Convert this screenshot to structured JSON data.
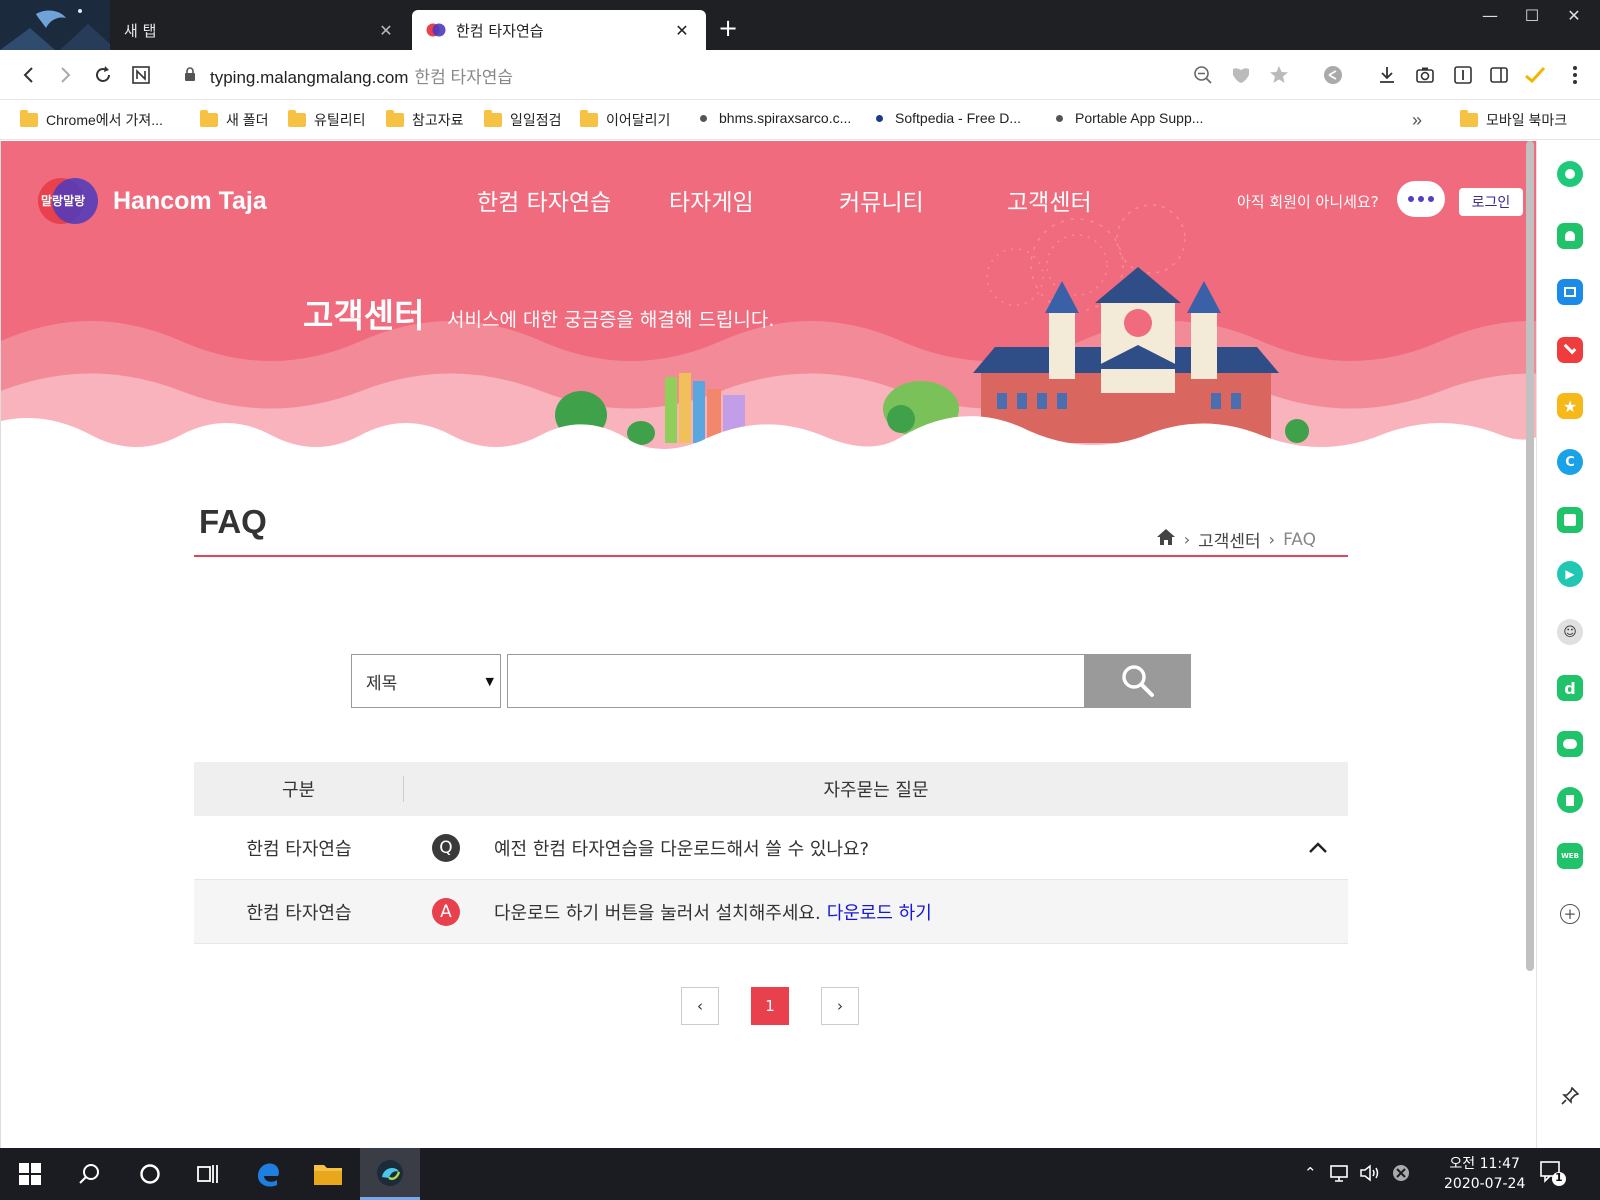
{
  "browser": {
    "tabs": [
      {
        "title": "새 탭",
        "active": false
      },
      {
        "title": "한컴 타자연습",
        "active": true
      }
    ],
    "new_tab_label": "+",
    "url": "typing.malangmalang.com",
    "page_name": "한컴 타자연습",
    "bookmarks": [
      {
        "label": "Chrome에서 가져...",
        "kind": "folder"
      },
      {
        "label": "새 폴더",
        "kind": "folder"
      },
      {
        "label": "유틸리티",
        "kind": "folder"
      },
      {
        "label": "참고자료",
        "kind": "folder"
      },
      {
        "label": "일일점검",
        "kind": "folder"
      },
      {
        "label": "이어달리기",
        "kind": "folder"
      },
      {
        "label": "bhms.spiraxsarco.c...",
        "kind": "site"
      },
      {
        "label": "Softpedia - Free D...",
        "kind": "site"
      },
      {
        "label": "Portable App Supp...",
        "kind": "site"
      }
    ],
    "bookmarks_overflow": "»",
    "mobile_bookmarks": "모바일 북마크"
  },
  "site": {
    "logo_text": "Hancom Taja",
    "logo_badge": "말랑말랑",
    "nav": [
      "한컴 타자연습",
      "타자게임",
      "커뮤니티",
      "고객센터"
    ],
    "member_prompt": "아직 회원이 아니세요?",
    "login_label": "로그인",
    "hero_title": "고객센터",
    "hero_subtitle": "서비스에 대한 궁금증을 해결해 드립니다.",
    "page_title": "FAQ",
    "breadcrumb": [
      "고객센터",
      "FAQ"
    ],
    "search": {
      "select_value": "제목",
      "input_value": ""
    },
    "table": {
      "headers": [
        "구분",
        "자주묻는 질문"
      ],
      "question": {
        "category": "한컴 타자연습",
        "badge": "Q",
        "text": "예전 한컴 타자연습을 다운로드해서 쓸 수 있나요?"
      },
      "answer": {
        "category": "한컴 타자연습",
        "badge": "A",
        "text": "다운로드 하기 버튼을 눌러서 설치해주세요.",
        "link": "다운로드 하기"
      }
    },
    "pagination": {
      "prev": "‹",
      "current": "1",
      "next": "›"
    }
  },
  "taskbar": {
    "time": "오전 11:47",
    "date": "2020-07-24",
    "notification_count": "1"
  },
  "colors": {
    "brand_pink": "#f06b7d",
    "accent_red": "#e8404d",
    "link_blue": "#1717d8",
    "login_purple": "#3a2a90"
  }
}
